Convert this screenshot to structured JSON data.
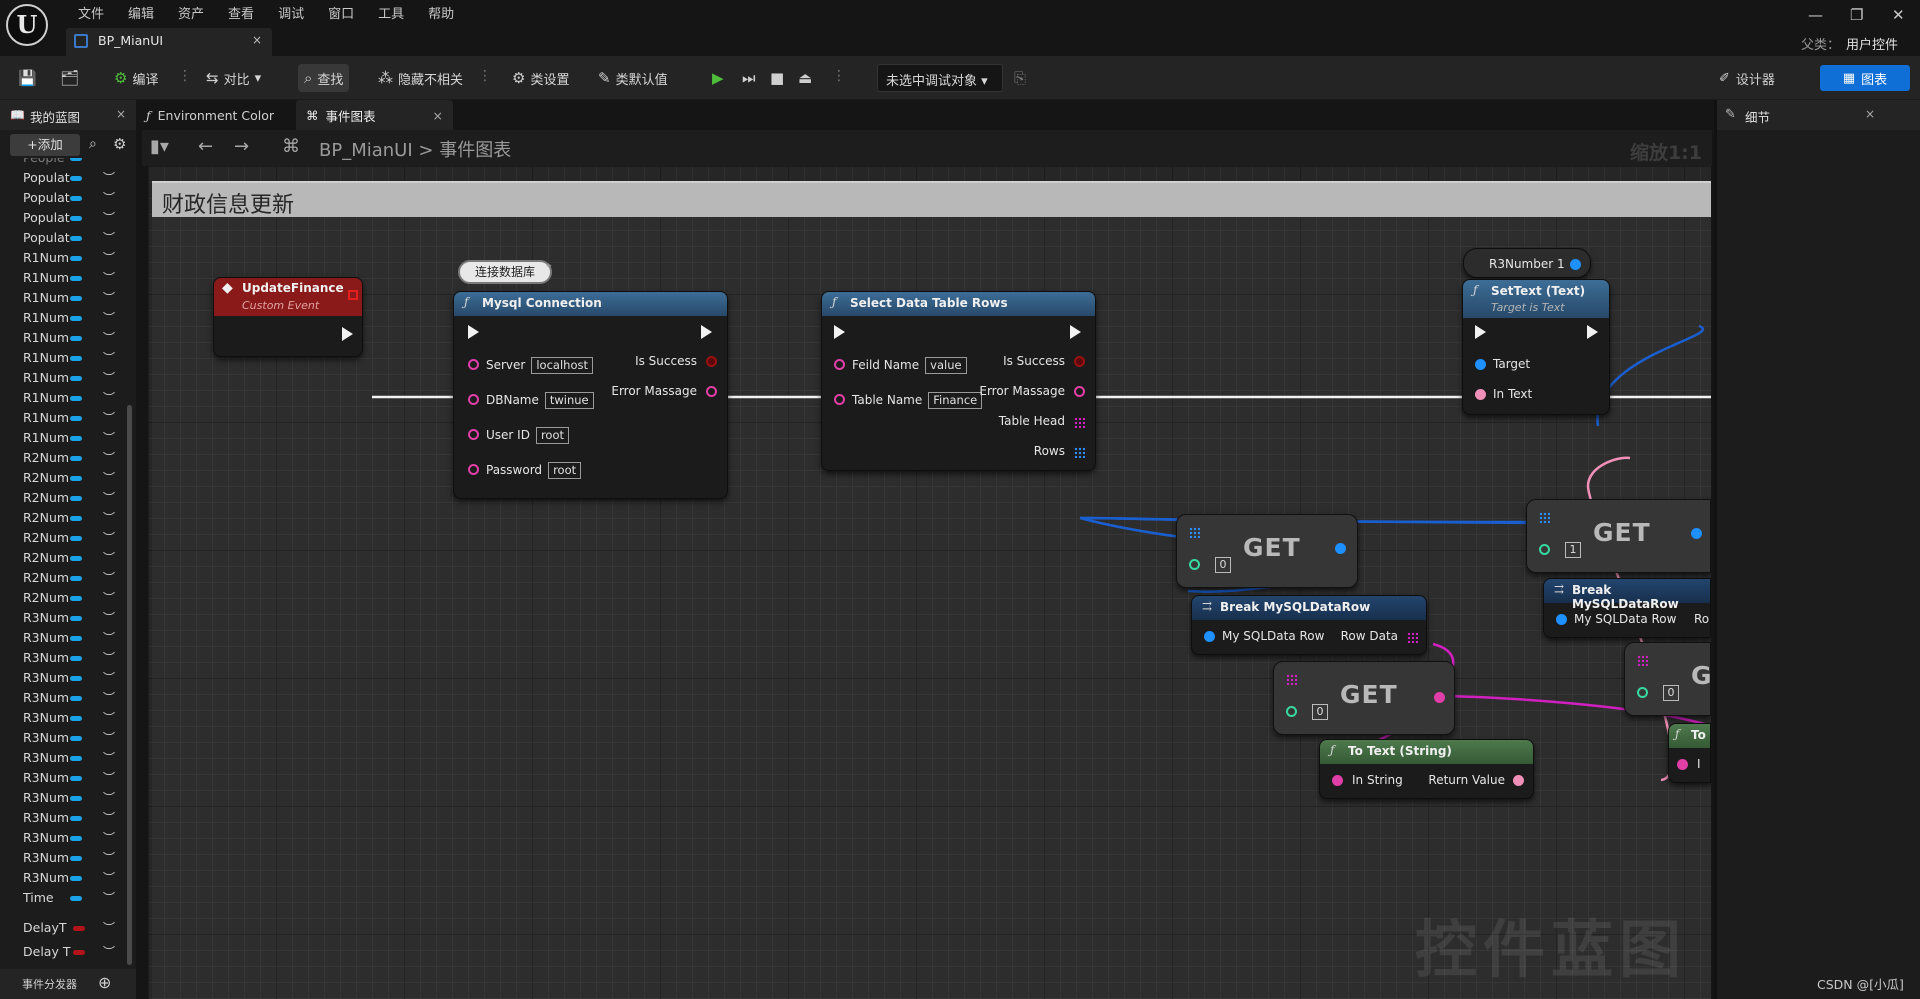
{
  "menu": [
    "文件",
    "编辑",
    "资产",
    "查看",
    "调试",
    "窗口",
    "工具",
    "帮助"
  ],
  "app_logo": "U",
  "doc_tab": {
    "label": "BP_MianUI",
    "close": "×"
  },
  "window_controls": {
    "minimize": "—",
    "restore": "❐",
    "close": "✕"
  },
  "parent": {
    "label": "父类：",
    "value": "用户控件"
  },
  "toolbar": {
    "compile": "编译",
    "diff": "对比",
    "find": "查找",
    "hide_unrelated": "隐藏不相关",
    "class_settings": "类设置",
    "class_defaults": "类默认值",
    "debug_target": "未选中调试对象",
    "designer": "设计器",
    "graph": "图表"
  },
  "left_panel": {
    "tab_label": "我的蓝图",
    "add_label": "添加",
    "variables": [
      {
        "name": "People"
      },
      {
        "name": "Populat"
      },
      {
        "name": "Populat"
      },
      {
        "name": "Populat"
      },
      {
        "name": "Populat"
      },
      {
        "name": "R1Num"
      },
      {
        "name": "R1Num"
      },
      {
        "name": "R1Num"
      },
      {
        "name": "R1Num"
      },
      {
        "name": "R1Num"
      },
      {
        "name": "R1Num"
      },
      {
        "name": "R1Num"
      },
      {
        "name": "R1Num"
      },
      {
        "name": "R1Num"
      },
      {
        "name": "R1Num"
      },
      {
        "name": "R2Num"
      },
      {
        "name": "R2Num"
      },
      {
        "name": "R2Num"
      },
      {
        "name": "R2Num"
      },
      {
        "name": "R2Num"
      },
      {
        "name": "R2Num"
      },
      {
        "name": "R2Num"
      },
      {
        "name": "R2Num"
      },
      {
        "name": "R3Num"
      },
      {
        "name": "R3Num"
      },
      {
        "name": "R3Num"
      },
      {
        "name": "R3Num"
      },
      {
        "name": "R3Num"
      },
      {
        "name": "R3Num"
      },
      {
        "name": "R3Num"
      },
      {
        "name": "R3Num"
      },
      {
        "name": "R3Num"
      },
      {
        "name": "R3Num"
      },
      {
        "name": "R3Num"
      },
      {
        "name": "R3Num"
      },
      {
        "name": "R3Num"
      },
      {
        "name": "R3Num"
      },
      {
        "name": "Time"
      }
    ],
    "delay_rows": [
      "DelayT",
      "Delay T"
    ],
    "footer": "事件分发器"
  },
  "center_tabs": [
    {
      "label": "Environment Color"
    },
    {
      "label": "事件图表",
      "close": "×"
    }
  ],
  "graph_header": {
    "crumb_root": "BP_MianUI",
    "crumb_sep": ">",
    "crumb_leaf": "事件图表",
    "zoom": "缩放1:1"
  },
  "comment_title": "财政信息更新",
  "comment_bubble": "连接数据库",
  "watermark": "控件蓝图",
  "nodes": {
    "update_finance": {
      "title": "UpdateFinance",
      "subtitle": "Custom Event"
    },
    "mysql_connection": {
      "title": "Mysql Connection",
      "inputs": [
        {
          "label": "Server",
          "value": "localhost"
        },
        {
          "label": "DBName",
          "value": "twinue"
        },
        {
          "label": "User ID",
          "value": "root"
        },
        {
          "label": "Password",
          "value": "root"
        }
      ],
      "outputs": [
        "Is Success",
        "Error Massage"
      ]
    },
    "select_rows": {
      "title": "Select Data Table Rows",
      "inputs": [
        {
          "label": "Feild Name",
          "value": "value"
        },
        {
          "label": "Table Name",
          "value": "Finance"
        }
      ],
      "outputs": [
        "Is Success",
        "Error Massage",
        "Table Head",
        "Rows"
      ]
    },
    "r3number": {
      "label": "R3Number 1"
    },
    "set_text": {
      "title": "SetText (Text)",
      "subtitle": "Target is Text",
      "inputs": [
        "Target",
        "In Text"
      ]
    },
    "get_a": {
      "title": "GET",
      "index": "0"
    },
    "get_b": {
      "title": "GET",
      "index": "1"
    },
    "get_c": {
      "title": "GET",
      "index": "0"
    },
    "get_d": {
      "title": "G",
      "index": "0"
    },
    "break_a": {
      "title": "Break MySQLDataRow",
      "input": "My SQLData Row",
      "output": "Row Data"
    },
    "break_b": {
      "title": "Break MySQLDataRow",
      "input": "My SQLData Row",
      "output": "Ro"
    },
    "to_text": {
      "title": "To Text (String)",
      "input": "In String",
      "output": "Return Value"
    },
    "to_text_partial": {
      "title": "To",
      "input": "I"
    }
  },
  "right_panel": {
    "tab_label": "细节"
  },
  "csdn": "CSDN @[小瓜]"
}
